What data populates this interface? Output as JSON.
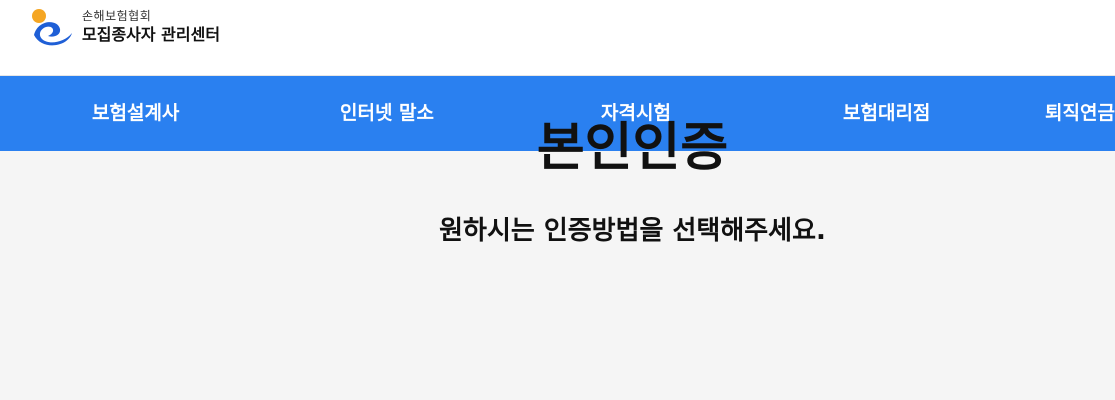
{
  "header": {
    "logo": {
      "org_name": "손해보험협회",
      "center_name": "모집종사자 관리센터",
      "colors": {
        "orange": "#f5a623",
        "blue": "#1f5fd6"
      }
    }
  },
  "nav": {
    "background": "#2a80f0",
    "items": [
      {
        "label": "보험설계사"
      },
      {
        "label": "인터넷 말소"
      },
      {
        "label": "자격시험"
      },
      {
        "label": "보험대리점"
      },
      {
        "label": "퇴직연금"
      }
    ]
  },
  "main": {
    "title": "본인인증",
    "subtitle": "원하시는 인증방법을 선택해주세요."
  }
}
